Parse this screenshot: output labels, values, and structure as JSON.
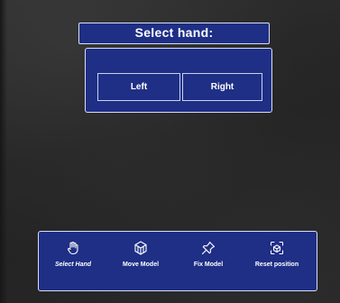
{
  "title_bar": {
    "text": "Select hand:"
  },
  "hand_panel": {
    "buttons": [
      {
        "label": "Left"
      },
      {
        "label": "Right"
      }
    ]
  },
  "toolbar": {
    "items": [
      {
        "label": "Select Hand",
        "icon": "hand-icon"
      },
      {
        "label": "Move Model",
        "icon": "cube-move-icon"
      },
      {
        "label": "Fix Model",
        "icon": "pin-icon"
      },
      {
        "label": "Reset position",
        "icon": "reset-scan-icon"
      }
    ]
  },
  "colors": {
    "panel_bg": "#1f2f86",
    "panel_border": "#d8def5",
    "text": "#ffffff",
    "background": "#262626"
  }
}
